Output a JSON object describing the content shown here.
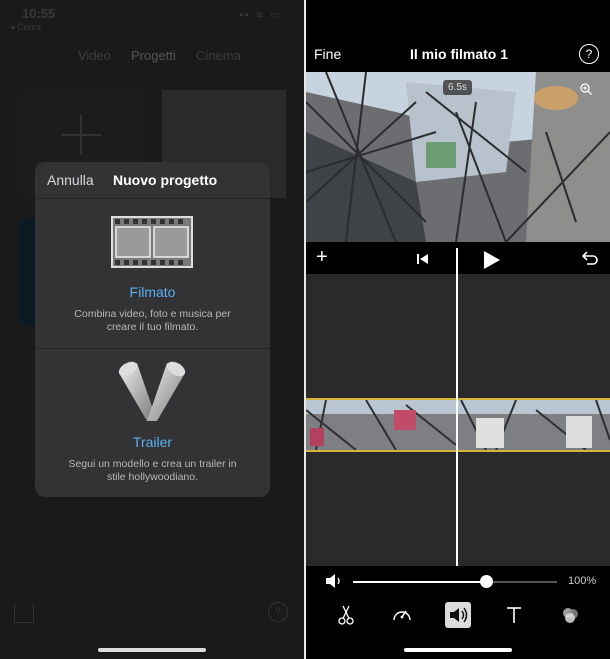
{
  "left": {
    "status": {
      "time": "10:55",
      "back": "◂ Cerca"
    },
    "nav_tabs": [
      {
        "label": "Video"
      },
      {
        "label": "Progetti"
      },
      {
        "label": "Cinema"
      }
    ],
    "dialog": {
      "cancel_label": "Annulla",
      "title": "Nuovo progetto",
      "options": [
        {
          "icon": "film-strip-icon",
          "label": "Filmato",
          "desc": "Combina video, foto e musica per creare il tuo filmato."
        },
        {
          "icon": "spotlights-icon",
          "label": "Trailer",
          "desc": "Segui un modello e crea un trailer in stile hollywoodiano."
        }
      ]
    },
    "bottom": {
      "import_icon": "import-icon",
      "help_icon": "help-icon",
      "help_label": "?"
    }
  },
  "right": {
    "header": {
      "done_label": "Fine",
      "title": "Il mio filmato 1",
      "help_label": "?"
    },
    "preview": {
      "duration": "6.5s",
      "zoom_icon": "zoom-icon"
    },
    "controls": {
      "add_label": "+",
      "prev_icon": "skip-back-icon",
      "play_icon": "play-icon",
      "undo_icon": "undo-icon"
    },
    "volume": {
      "level": 0.65,
      "percent_label": "100%"
    },
    "tools": [
      {
        "icon": "scissors-icon",
        "active": false
      },
      {
        "icon": "speed-icon",
        "active": false
      },
      {
        "icon": "volume-icon",
        "active": true
      },
      {
        "icon": "text-icon",
        "active": false
      },
      {
        "icon": "filters-icon",
        "active": false
      }
    ]
  },
  "colors": {
    "accent_blue": "#5ab0f0",
    "clip_border": "#d6b33a",
    "dialog_bg": "#333335"
  }
}
